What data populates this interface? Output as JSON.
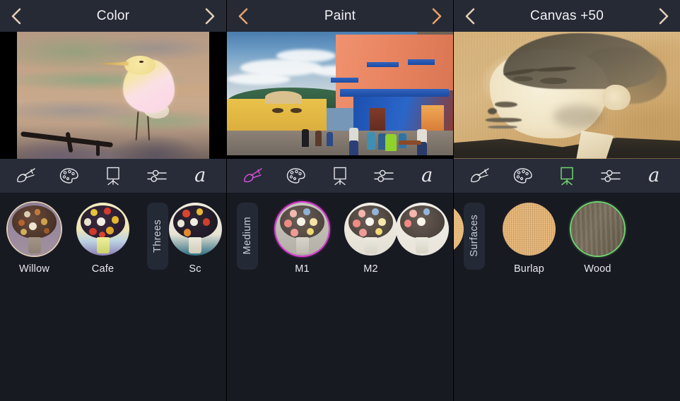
{
  "panels": [
    {
      "id": "color",
      "header": {
        "title": "Color",
        "prev_icon": "chevron-left-icon",
        "next_icon": "chevron-right-icon",
        "chevron_color": "#e2cdb6"
      },
      "artwork": {
        "name": "pastel-bird-painting"
      },
      "toolbar": {
        "active": "none",
        "accent": "#e6e6ea",
        "items": [
          {
            "icon": "brush-icon",
            "name": "brush"
          },
          {
            "icon": "palette-icon",
            "name": "color"
          },
          {
            "icon": "easel-icon",
            "name": "canvas"
          },
          {
            "icon": "sliders-icon",
            "name": "adjust"
          },
          {
            "icon": "text-a-icon",
            "name": "text",
            "glyph": "a"
          }
        ]
      },
      "strip": [
        {
          "kind": "thumb",
          "label": "Willow",
          "selected": true,
          "ring": "#e2cdb6",
          "art": "bouquet-muted"
        },
        {
          "kind": "thumb",
          "label": "Cafe",
          "selected": false,
          "art": "bouquet-bright"
        },
        {
          "kind": "separator",
          "label": "Threes"
        },
        {
          "kind": "thumb",
          "label": "Sc",
          "selected": false,
          "art": "bouquet-white",
          "partial": true
        }
      ]
    },
    {
      "id": "paint",
      "header": {
        "title": "Paint",
        "prev_icon": "chevron-left-icon",
        "next_icon": "chevron-right-icon",
        "chevron_color": "#e8a06a"
      },
      "artwork": {
        "name": "colonial-street-painting"
      },
      "toolbar": {
        "active": "brush",
        "accent": "#d24fd2",
        "items": [
          {
            "icon": "brush-icon",
            "name": "brush"
          },
          {
            "icon": "palette-icon",
            "name": "color"
          },
          {
            "icon": "easel-icon",
            "name": "canvas"
          },
          {
            "icon": "sliders-icon",
            "name": "adjust"
          },
          {
            "icon": "text-a-icon",
            "name": "text",
            "glyph": "a"
          }
        ]
      },
      "strip": [
        {
          "kind": "separator",
          "label": "Medium"
        },
        {
          "kind": "thumb",
          "label": "M1",
          "selected": true,
          "ring": "#e040d8",
          "art": "bouquet-pastel"
        },
        {
          "kind": "thumb",
          "label": "M2",
          "selected": false,
          "art": "bouquet-light"
        },
        {
          "kind": "thumb",
          "label": "",
          "selected": false,
          "art": "bouquet-light",
          "partial": true
        }
      ]
    },
    {
      "id": "canvas",
      "header": {
        "title": "Canvas +50",
        "prev_icon": "chevron-left-icon",
        "next_icon": "chevron-right-icon",
        "chevron_color": "#e2cdb6"
      },
      "artwork": {
        "name": "sepia-portrait-painting"
      },
      "toolbar": {
        "active": "canvas",
        "accent": "#72d372",
        "items": [
          {
            "icon": "brush-icon",
            "name": "brush"
          },
          {
            "icon": "palette-icon",
            "name": "color"
          },
          {
            "icon": "easel-icon",
            "name": "canvas"
          },
          {
            "icon": "sliders-icon",
            "name": "adjust"
          },
          {
            "icon": "text-a-icon",
            "name": "text",
            "glyph": "a"
          }
        ]
      },
      "strip": [
        {
          "kind": "thumb",
          "label": "",
          "selected": false,
          "art": "canvas-tan",
          "partial": true
        },
        {
          "kind": "separator",
          "label": "Surfaces"
        },
        {
          "kind": "thumb",
          "label": "Burlap",
          "selected": false,
          "art": "burlap"
        },
        {
          "kind": "thumb",
          "label": "Wood",
          "selected": true,
          "ring": "#72d372",
          "art": "wood"
        }
      ]
    }
  ],
  "colors": {
    "header_bg": "#252a35",
    "toolbar_bg": "#272c38",
    "strip_bg": "#181a22",
    "title_text": "#f2f2f4",
    "label_text": "#e9e9ee",
    "separator_chip": "#242936"
  }
}
